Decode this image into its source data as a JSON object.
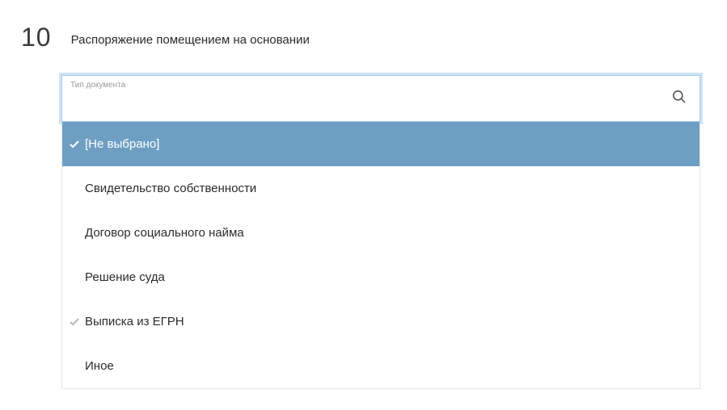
{
  "section": {
    "number": "10",
    "title": "Распоряжение помещением на основании"
  },
  "field": {
    "label": "Тип документа",
    "value": ""
  },
  "options": [
    {
      "label": "[Не выбрано]",
      "selected": true,
      "checked": true
    },
    {
      "label": "Свидетельство собственности",
      "selected": false,
      "checked": false
    },
    {
      "label": "Договор социального найма",
      "selected": false,
      "checked": false
    },
    {
      "label": "Решение суда",
      "selected": false,
      "checked": false
    },
    {
      "label": "Выписка из ЕГРН",
      "selected": false,
      "checked": true
    },
    {
      "label": "Иное",
      "selected": false,
      "checked": false
    }
  ]
}
